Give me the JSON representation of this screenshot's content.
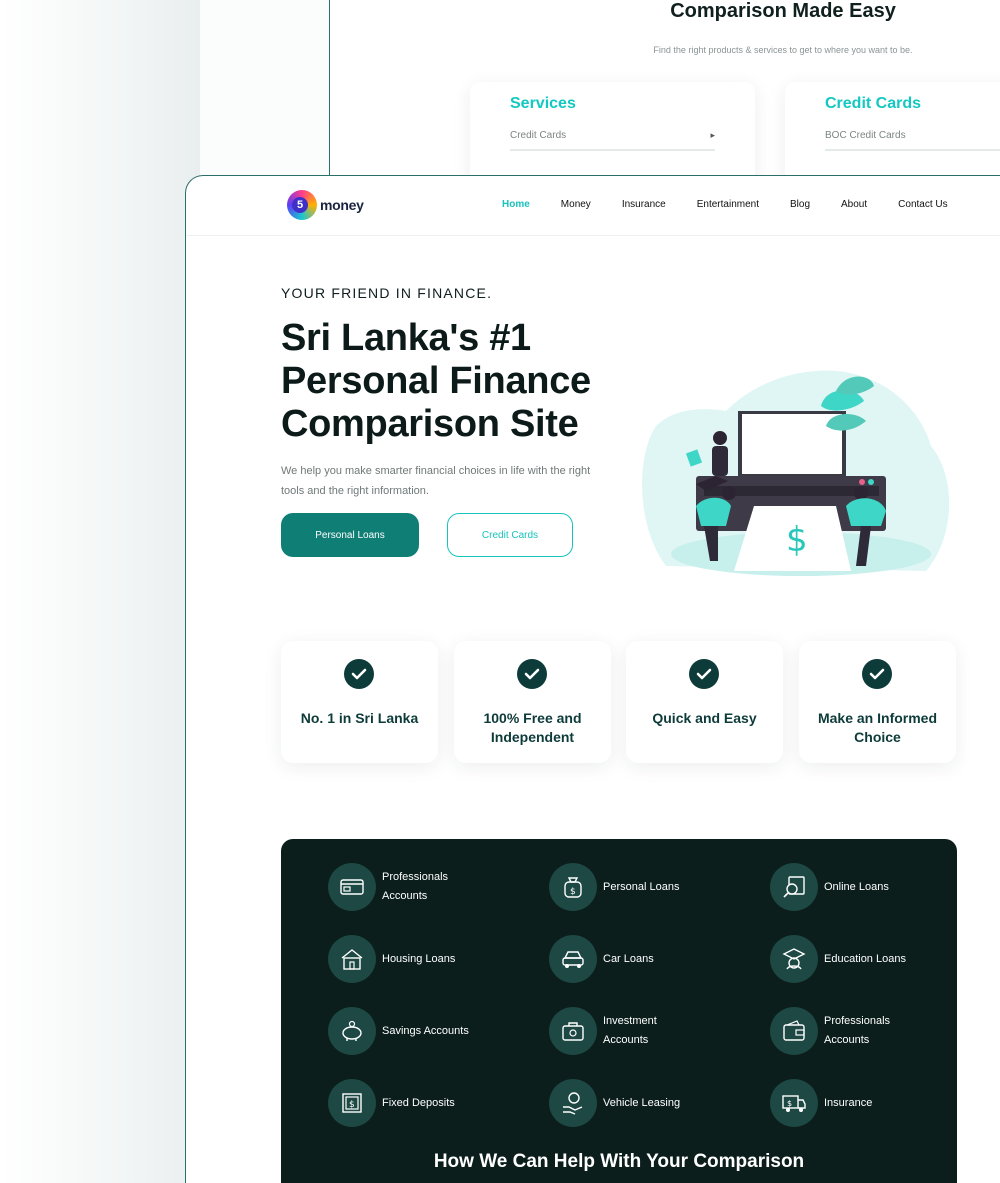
{
  "back_window": {
    "title": "Comparison Made Easy",
    "subtitle": "Find the right products & services to get to where you want to be.",
    "cards": [
      {
        "heading": "Services",
        "row": "Credit Cards"
      },
      {
        "heading": "Credit Cards",
        "row": "BOC Credit Cards"
      }
    ]
  },
  "brand": {
    "logo_digit": "5",
    "logo_text": "money"
  },
  "nav": {
    "items": [
      "Home",
      "Money",
      "Insurance",
      "Entertainment",
      "Blog",
      "About",
      "Contact Us"
    ],
    "active": "Home"
  },
  "hero": {
    "eyebrow": "YOUR FRIEND IN FINANCE.",
    "headline": "Sri Lanka's #1 Personal Finance Comparison Site",
    "lead": "We help you make smarter financial choices in life with the right tools and the right information.",
    "primary_button": "Personal Loans",
    "secondary_button": "Credit Cards",
    "illustration_symbol": "$"
  },
  "features": [
    {
      "label": "No. 1 in Sri Lanka",
      "icon": "check-circle-icon"
    },
    {
      "label": "100% Free and Independent",
      "icon": "check-circle-icon"
    },
    {
      "label": "Quick and Easy",
      "icon": "check-circle-icon"
    },
    {
      "label": "Make an Informed Choice",
      "icon": "check-circle-icon"
    }
  ],
  "services": {
    "items": [
      {
        "label": "Professionals Accounts",
        "icon": "card-icon"
      },
      {
        "label": "Personal Loans",
        "icon": "money-bag-icon"
      },
      {
        "label": "Online Loans",
        "icon": "online-loan-icon"
      },
      {
        "label": "Housing Loans",
        "icon": "house-icon"
      },
      {
        "label": "Car Loans",
        "icon": "car-icon"
      },
      {
        "label": "Education Loans",
        "icon": "graduation-icon"
      },
      {
        "label": "Savings Accounts",
        "icon": "piggy-bank-icon"
      },
      {
        "label": "Investment Accounts",
        "icon": "briefcase-icon"
      },
      {
        "label": "Professionals Accounts",
        "icon": "wallet-icon"
      },
      {
        "label": "Fixed Deposits",
        "icon": "dollar-box-icon"
      },
      {
        "label": "Vehicle Leasing",
        "icon": "hand-coin-icon"
      },
      {
        "label": "Insurance",
        "icon": "truck-dollar-icon"
      }
    ],
    "heading": "How We Can Help With Your Comparison"
  },
  "colors": {
    "accent": "#17c3bd",
    "primary": "#0f7e75",
    "dark": "#0b1e1c",
    "icon_bg": "#1d4844"
  }
}
